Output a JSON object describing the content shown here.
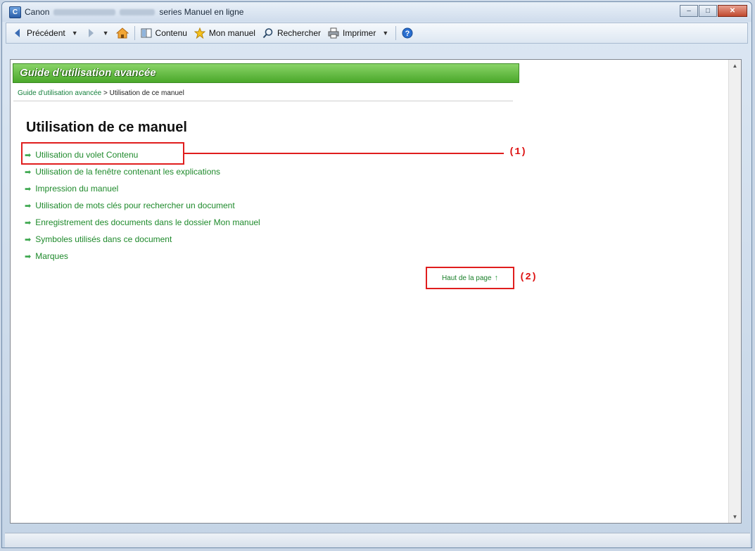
{
  "window": {
    "title_prefix": "Canon",
    "title_suffix": "series Manuel en ligne",
    "controls": {
      "minimize": "–",
      "maximize": "□",
      "close": "✕"
    }
  },
  "toolbar": {
    "back_label": "Précédent",
    "contents_label": "Contenu",
    "my_manual_label": "Mon manuel",
    "search_label": "Rechercher",
    "print_label": "Imprimer",
    "help_label": "?"
  },
  "content": {
    "header": "Guide d'utilisation avancée",
    "breadcrumb": {
      "link": "Guide d'utilisation avancée",
      "separator": " > ",
      "current": "Utilisation de ce manuel"
    },
    "page_title": "Utilisation de ce manuel",
    "links": [
      "Utilisation du volet Contenu",
      "Utilisation de la fenêtre contenant les explications",
      "Impression du manuel",
      "Utilisation de mots clés pour rechercher un document",
      "Enregistrement des documents dans le dossier Mon manuel",
      "Symboles utilisés dans ce document",
      "Marques"
    ],
    "top_of_page": "Haut de la page",
    "top_of_page_icon": "↑"
  },
  "callouts": {
    "one": "(1)",
    "two": "(2)"
  },
  "colors": {
    "accent_green": "#4aa82a",
    "link_green": "#1f8a2c",
    "callout_red": "#e01e1e"
  }
}
